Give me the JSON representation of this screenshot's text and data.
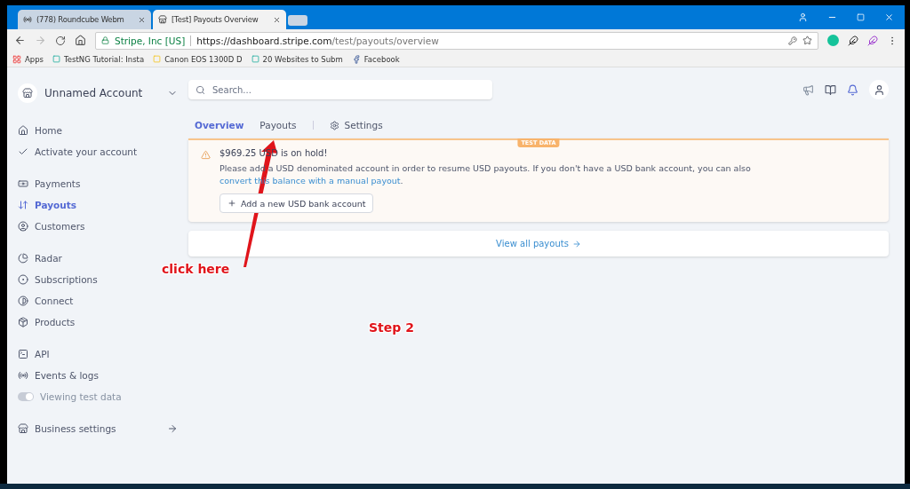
{
  "browser": {
    "tabs": [
      {
        "title": "(778) Roundcube Webm",
        "selected": false
      },
      {
        "title": "[Test] Payouts Overview",
        "selected": true
      }
    ],
    "address": {
      "site": "Stripe, Inc [US]",
      "host": "https://dashboard.stripe.com",
      "path": "/test/payouts/overview"
    },
    "bookmarks": [
      "Apps",
      "TestNG Tutorial: Insta",
      "Canon EOS 1300D D",
      "20 Websites to Subm",
      "Facebook"
    ]
  },
  "sidebar": {
    "account": "Unnamed Account",
    "groups": [
      [
        {
          "label": "Home",
          "selected": false
        },
        {
          "label": "Activate your account",
          "selected": false
        }
      ],
      [
        {
          "label": "Payments",
          "selected": false
        },
        {
          "label": "Payouts",
          "selected": true
        },
        {
          "label": "Customers",
          "selected": false
        }
      ],
      [
        {
          "label": "Radar",
          "selected": false
        },
        {
          "label": "Subscriptions",
          "selected": false
        },
        {
          "label": "Connect",
          "selected": false
        },
        {
          "label": "Products",
          "selected": false
        }
      ],
      [
        {
          "label": "API",
          "selected": false
        },
        {
          "label": "Events & logs",
          "selected": false
        }
      ]
    ],
    "test_toggle": {
      "label": "Viewing test data",
      "on": true
    },
    "business_settings": "Business settings"
  },
  "search": {
    "placeholder": "Search..."
  },
  "tabs": [
    {
      "label": "Overview",
      "selected": true
    },
    {
      "label": "Payouts",
      "selected": false
    },
    {
      "label": "Settings",
      "selected": false
    }
  ],
  "alert": {
    "badge": "TEST DATA",
    "title": "$969.25 USD is on hold!",
    "message": "Please add a USD denominated account in order to resume USD payouts. If you don't have a USD bank account, you can also",
    "link": "convert this balance with a manual payout",
    "after_link": ".",
    "button": "Add a new USD bank account"
  },
  "view_all": "View all payouts",
  "annotations": {
    "click_label": "click here",
    "step_label": "Step 2"
  }
}
